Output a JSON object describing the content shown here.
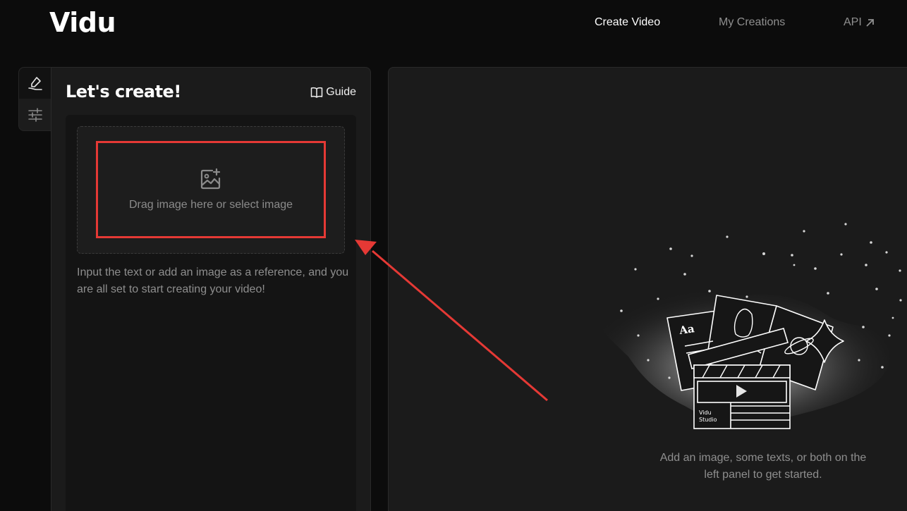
{
  "header": {
    "logo": "Vidu",
    "nav": {
      "create_video": "Create Video",
      "my_creations": "My Creations",
      "api": "API"
    }
  },
  "sidebar": {
    "tabs": [
      {
        "icon": "pen-write-icon",
        "active": true
      },
      {
        "icon": "sliders-icon",
        "active": false
      }
    ]
  },
  "left_panel": {
    "title": "Let's create!",
    "guide_label": "Guide",
    "dropzone_text": "Drag image here or select image",
    "helper_text": "Input the text or add an image as a reference, and you are all set to start creating your video!"
  },
  "right_panel": {
    "illustration": {
      "card_text_aa": "Aa",
      "brand_line1": "Vidu",
      "brand_line2": "Studio"
    },
    "hint": "Add an image, some texts, or both on the left panel to get started."
  },
  "colors": {
    "background": "#0c0c0c",
    "panel": "#1b1b1b",
    "annotation_red": "#e53935"
  }
}
